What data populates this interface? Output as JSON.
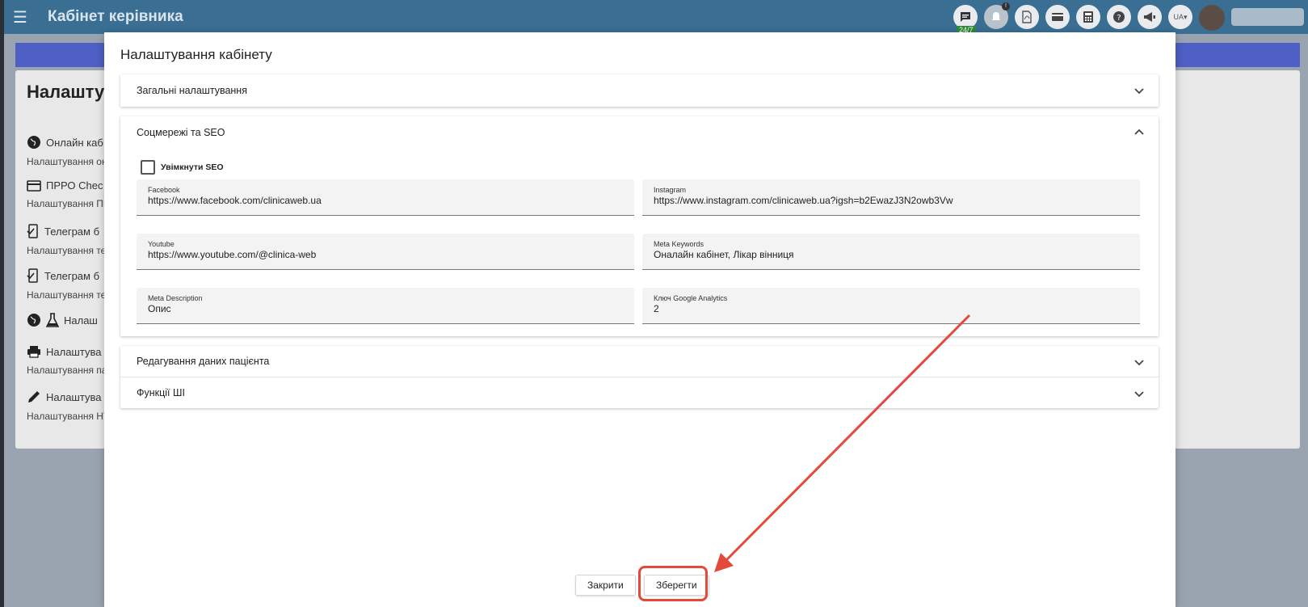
{
  "topbar": {
    "title": "Кабінет керівника",
    "badge_24_7": "24/7",
    "lang": "UA",
    "icons": [
      "chat-icon",
      "notification-icon",
      "pdf-icon",
      "card-icon",
      "calculator-icon",
      "help-icon",
      "megaphone-icon"
    ]
  },
  "background": {
    "heading": "Налашту",
    "items": [
      {
        "label": "Онлайн каб",
        "sub": "Налаштування он"
      },
      {
        "label": "ПРРО Chec",
        "sub": "Налаштування ПР"
      },
      {
        "label": "Телеграм б",
        "sub": "Налаштування те"
      },
      {
        "label": "Телеграм б",
        "sub": "Налаштування те"
      },
      {
        "label": "Налаш",
        "sub": ""
      },
      {
        "label": "Налаштува",
        "sub": "Налаштування па"
      },
      {
        "label": "Налаштува",
        "sub": "Налаштування НТ"
      }
    ]
  },
  "modal": {
    "title": "Налаштування кабінету",
    "panels": {
      "general": "Загальні налаштування",
      "social": "Соцмережі та SEO",
      "patient": "Редагування даних пацієнта",
      "ai": "Функції ШІ"
    },
    "seo_checkbox": "Увімкнути SEO",
    "fields": {
      "facebook": {
        "label": "Facebook",
        "value": "https://www.facebook.com/clinicaweb.ua"
      },
      "instagram": {
        "label": "Instagram",
        "value": "https://www.instagram.com/clinicaweb.ua?igsh=b2EwazJ3N2owb3Vw"
      },
      "youtube": {
        "label": "Youtube",
        "value": "https://www.youtube.com/@clinica-web"
      },
      "meta_keywords": {
        "label": "Meta Keywords",
        "value": "Оналайн кабінет, Лікар вінниця"
      },
      "meta_description": {
        "label": "Meta Description",
        "value": "Опис"
      },
      "ga_key": {
        "label": "Ключ Google Analytics",
        "value": "2"
      }
    },
    "close_label": "Закрити",
    "save_label": "Зберегти"
  },
  "colors": {
    "topbar": "#3a6f93",
    "banner": "#4e5fc6",
    "annotation": "#e24a3b"
  }
}
